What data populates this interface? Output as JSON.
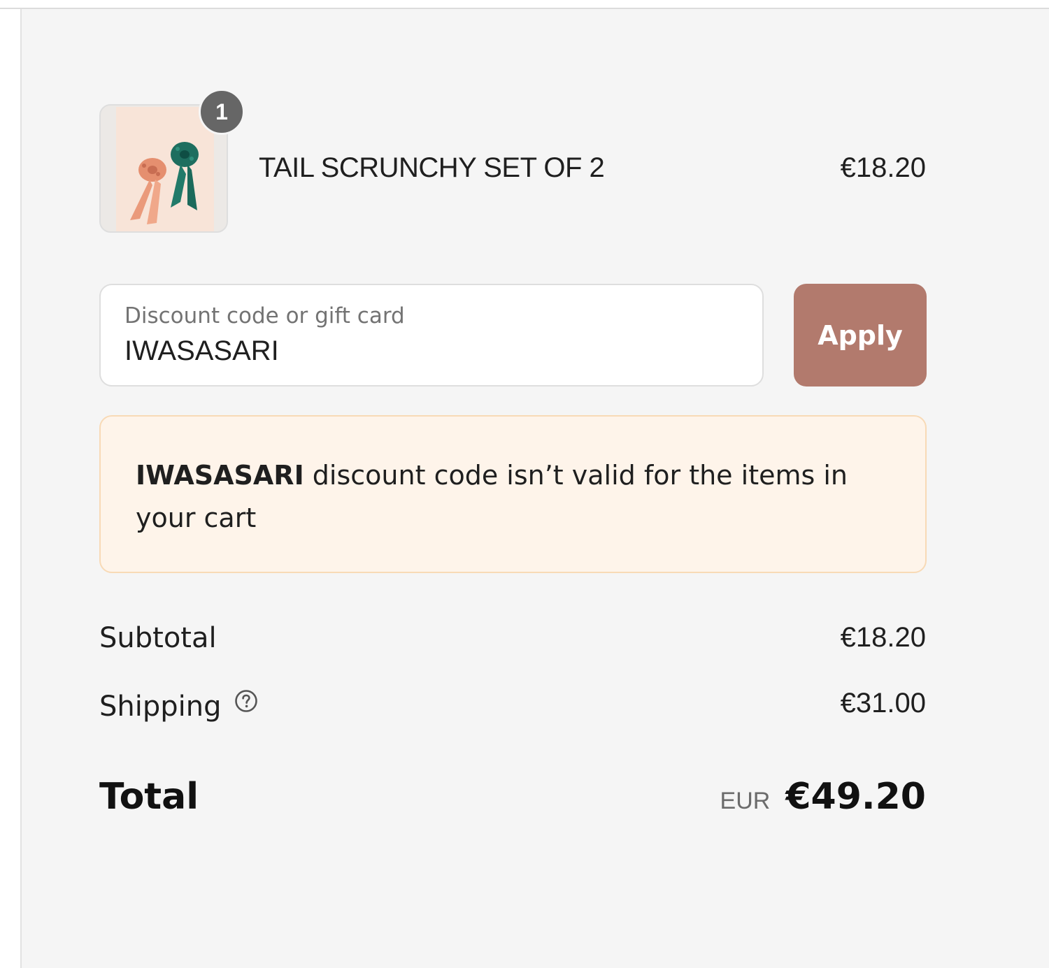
{
  "cart": {
    "items": [
      {
        "quantity": "1",
        "name": "TAIL SCRUNCHY SET OF 2",
        "price": "€18.20",
        "thumbnail": "scrunchy-photo"
      }
    ]
  },
  "discount": {
    "placeholder": "Discount code or gift card",
    "value": "IWASASARI",
    "apply_label": "Apply",
    "button_color": "#b27a6d"
  },
  "warning": {
    "code": "IWASASARI",
    "message": " discount code isn’t valid for the items in your cart",
    "background": "#fef4ea"
  },
  "summary": {
    "subtotal_label": "Subtotal",
    "subtotal_value": "€18.20",
    "shipping_label": "Shipping",
    "shipping_icon": "question-circle-icon",
    "shipping_value": "€31.00",
    "total_label": "Total",
    "currency": "EUR",
    "total_value": "€49.20"
  }
}
